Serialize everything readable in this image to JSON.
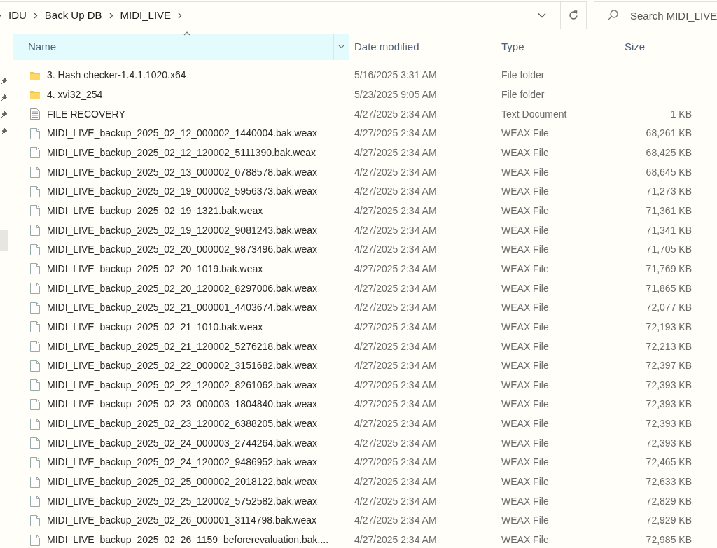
{
  "address_bar": {
    "path": [
      "IDU",
      "Back Up DB",
      "MIDI_LIVE"
    ]
  },
  "search": {
    "placeholder": "Search MIDI_LIVE"
  },
  "columns": [
    {
      "label": "Name",
      "sorted": true
    },
    {
      "label": "Date modified",
      "sorted": false
    },
    {
      "label": "Type",
      "sorted": false
    },
    {
      "label": "Size",
      "sorted": false
    }
  ],
  "rows": [
    {
      "kind": "folder",
      "name": "3. Hash checker-1.4.1.1020.x64",
      "date": "5/16/2025 3:31 AM",
      "type": "File folder"
    },
    {
      "kind": "folder",
      "name": "4. xvi32_254",
      "date": "5/23/2025 9:05 AM",
      "type": "File folder"
    },
    {
      "kind": "text",
      "name": "FILE RECOVERY",
      "date": "4/27/2025 2:34 AM",
      "type": "Text Document",
      "size": "1 KB"
    },
    {
      "kind": "file",
      "name": "MIDI_LIVE_backup_2025_02_12_000002_1440004.bak.weax",
      "date": "4/27/2025 2:34 AM",
      "type": "WEAX File",
      "size": "68,261 KB"
    },
    {
      "kind": "file",
      "name": "MIDI_LIVE_backup_2025_02_12_120002_5111390.bak.weax",
      "date": "4/27/2025 2:34 AM",
      "type": "WEAX File",
      "size": "68,425 KB"
    },
    {
      "kind": "file",
      "name": "MIDI_LIVE_backup_2025_02_13_000002_0788578.bak.weax",
      "date": "4/27/2025 2:34 AM",
      "type": "WEAX File",
      "size": "68,645 KB"
    },
    {
      "kind": "file",
      "name": "MIDI_LIVE_backup_2025_02_19_000002_5956373.bak.weax",
      "date": "4/27/2025 2:34 AM",
      "type": "WEAX File",
      "size": "71,273 KB"
    },
    {
      "kind": "file",
      "name": "MIDI_LIVE_backup_2025_02_19_1321.bak.weax",
      "date": "4/27/2025 2:34 AM",
      "type": "WEAX File",
      "size": "71,361 KB"
    },
    {
      "kind": "file",
      "name": "MIDI_LIVE_backup_2025_02_19_120002_9081243.bak.weax",
      "date": "4/27/2025 2:34 AM",
      "type": "WEAX File",
      "size": "71,341 KB"
    },
    {
      "kind": "file",
      "name": "MIDI_LIVE_backup_2025_02_20_000002_9873496.bak.weax",
      "date": "4/27/2025 2:34 AM",
      "type": "WEAX File",
      "size": "71,705 KB"
    },
    {
      "kind": "file",
      "name": "MIDI_LIVE_backup_2025_02_20_1019.bak.weax",
      "date": "4/27/2025 2:34 AM",
      "type": "WEAX File",
      "size": "71,769 KB"
    },
    {
      "kind": "file",
      "name": "MIDI_LIVE_backup_2025_02_20_120002_8297006.bak.weax",
      "date": "4/27/2025 2:34 AM",
      "type": "WEAX File",
      "size": "71,865 KB"
    },
    {
      "kind": "file",
      "name": "MIDI_LIVE_backup_2025_02_21_000001_4403674.bak.weax",
      "date": "4/27/2025 2:34 AM",
      "type": "WEAX File",
      "size": "72,077 KB"
    },
    {
      "kind": "file",
      "name": "MIDI_LIVE_backup_2025_02_21_1010.bak.weax",
      "date": "4/27/2025 2:34 AM",
      "type": "WEAX File",
      "size": "72,193 KB"
    },
    {
      "kind": "file",
      "name": "MIDI_LIVE_backup_2025_02_21_120002_5276218.bak.weax",
      "date": "4/27/2025 2:34 AM",
      "type": "WEAX File",
      "size": "72,213 KB"
    },
    {
      "kind": "file",
      "name": "MIDI_LIVE_backup_2025_02_22_000002_3151682.bak.weax",
      "date": "4/27/2025 2:34 AM",
      "type": "WEAX File",
      "size": "72,397 KB"
    },
    {
      "kind": "file",
      "name": "MIDI_LIVE_backup_2025_02_22_120002_8261062.bak.weax",
      "date": "4/27/2025 2:34 AM",
      "type": "WEAX File",
      "size": "72,393 KB"
    },
    {
      "kind": "file",
      "name": "MIDI_LIVE_backup_2025_02_23_000003_1804840.bak.weax",
      "date": "4/27/2025 2:34 AM",
      "type": "WEAX File",
      "size": "72,393 KB"
    },
    {
      "kind": "file",
      "name": "MIDI_LIVE_backup_2025_02_23_120002_6388205.bak.weax",
      "date": "4/27/2025 2:34 AM",
      "type": "WEAX File",
      "size": "72,393 KB"
    },
    {
      "kind": "file",
      "name": "MIDI_LIVE_backup_2025_02_24_000003_2744264.bak.weax",
      "date": "4/27/2025 2:34 AM",
      "type": "WEAX File",
      "size": "72,393 KB"
    },
    {
      "kind": "file",
      "name": "MIDI_LIVE_backup_2025_02_24_120002_9486952.bak.weax",
      "date": "4/27/2025 2:34 AM",
      "type": "WEAX File",
      "size": "72,465 KB"
    },
    {
      "kind": "file",
      "name": "MIDI_LIVE_backup_2025_02_25_000002_2018122.bak.weax",
      "date": "4/27/2025 2:34 AM",
      "type": "WEAX File",
      "size": "72,633 KB"
    },
    {
      "kind": "file",
      "name": "MIDI_LIVE_backup_2025_02_25_120002_5752582.bak.weax",
      "date": "4/27/2025 2:34 AM",
      "type": "WEAX File",
      "size": "72,829 KB"
    },
    {
      "kind": "file",
      "name": "MIDI_LIVE_backup_2025_02_26_000001_3114798.bak.weax",
      "date": "4/27/2025 2:34 AM",
      "type": "WEAX File",
      "size": "72,929 KB"
    },
    {
      "kind": "file",
      "name": "MIDI_LIVE_backup_2025_02_26_1159_beforerevaluation.bak....",
      "date": "4/27/2025 2:34 AM",
      "type": "WEAX File",
      "size": "72,985 KB"
    }
  ]
}
